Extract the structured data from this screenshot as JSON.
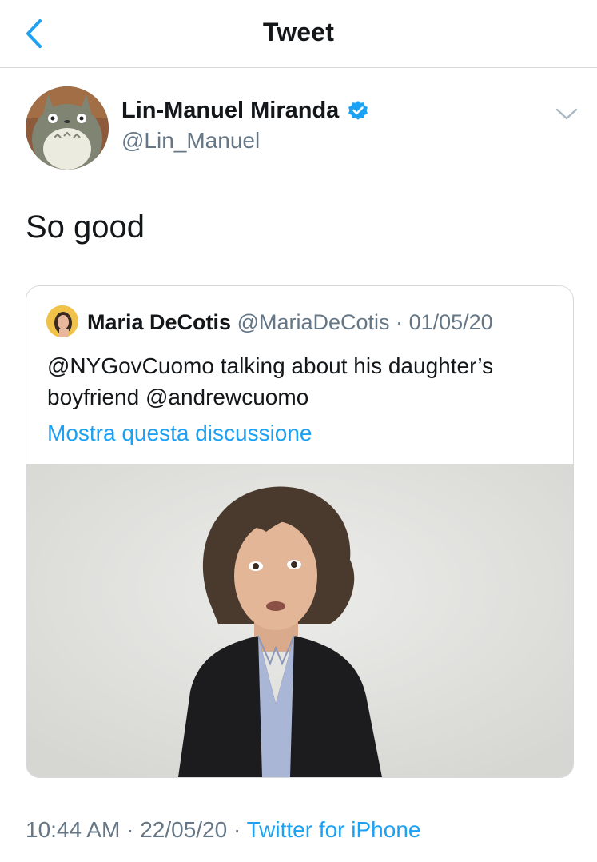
{
  "nav": {
    "title": "Tweet"
  },
  "author": {
    "name": "Lin-Manuel Miranda",
    "handle": "@Lin_Manuel",
    "verified": true
  },
  "tweet": {
    "text": "So good"
  },
  "quoted_tweet": {
    "name": "Maria DeCotis",
    "handle": "@MariaDeCotis",
    "separator": "·",
    "date": "01/05/20",
    "text": "@NYGovCuomo talking about his daughter’s boyfriend @andrewcuomo",
    "thread_link": "Mostra questa discussione"
  },
  "meta": {
    "time": "10:44 AM",
    "separator": "·",
    "date": "22/05/20",
    "source": "Twitter for iPhone"
  },
  "colors": {
    "link_blue": "#1da1f2",
    "secondary_text": "#657786",
    "border": "#d5d9dc"
  }
}
